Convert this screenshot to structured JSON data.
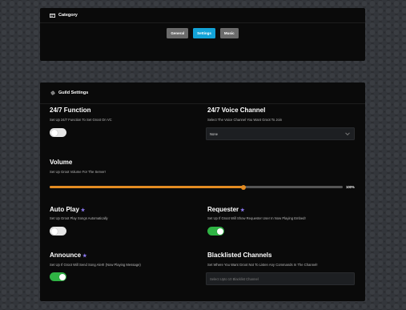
{
  "category": {
    "title": "Category",
    "tabs": [
      {
        "label": "General",
        "active": false
      },
      {
        "label": "Settings",
        "active": true
      },
      {
        "label": "Music",
        "active": false
      }
    ]
  },
  "guild": {
    "title": "Guild Settings",
    "function247": {
      "title": "24/7 Function",
      "desc": "Set Up 24/7 Function To Set Groot On VC",
      "enabled": false
    },
    "voice247": {
      "title": "24/7 Voice Channel",
      "desc": "Select The Voice Channel You Want Groot To Join",
      "selected": "None"
    },
    "volume": {
      "title": "Volume",
      "desc": "Set Up Groot Volume For The Server!",
      "value": 100,
      "percent_label": "100%"
    },
    "autoplay": {
      "title": "Auto Play",
      "desc": "Set Up Groot Play Songs Automatically",
      "enabled": false
    },
    "requester": {
      "title": "Requester",
      "desc": "Set Up If Groot Will Show Requester User In Now Playing Embed!",
      "enabled": true
    },
    "announce": {
      "title": "Announce",
      "desc": "Set Up If Groot Will Send Song Alert! (Now Playing Message)",
      "enabled": true
    },
    "blacklist": {
      "title": "Blacklisted Channels",
      "desc": "Set Where You Want Groot Not To Listen Any Commands In The Channel!",
      "placeholder": "Select Upto 10 Blacklist Channel"
    }
  },
  "colors": {
    "accent": "#13a3d8",
    "slider": "#e38b22",
    "toggle_on": "#2fb344",
    "premium_star": "#8f7cf7"
  },
  "icons": {
    "category": "card-icon",
    "guild": "gear-icon",
    "premium": "star-icon"
  }
}
